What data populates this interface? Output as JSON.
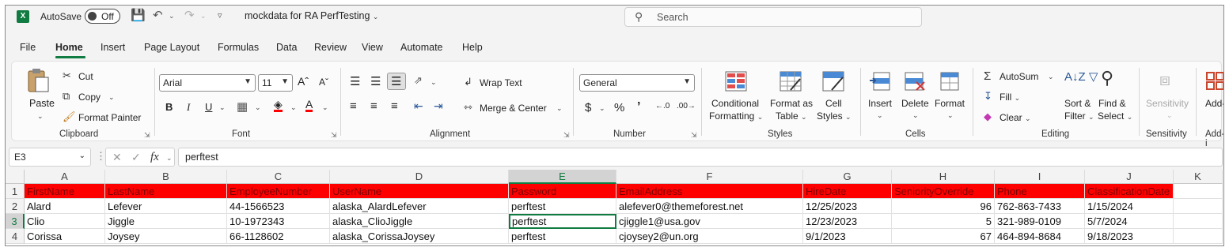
{
  "titlebar": {
    "app_logo": "X",
    "autosave_label": "AutoSave",
    "autosave_state": "Off",
    "document_title": "mockdata for RA PerfTesting",
    "search_placeholder": "Search"
  },
  "tabs": [
    "File",
    "Home",
    "Insert",
    "Page Layout",
    "Formulas",
    "Data",
    "Review",
    "View",
    "Automate",
    "Help"
  ],
  "active_tab": "Home",
  "ribbon": {
    "clipboard": {
      "paste": "Paste",
      "cut": "Cut",
      "copy": "Copy",
      "format_painter": "Format Painter",
      "label": "Clipboard"
    },
    "font": {
      "font_name": "Arial",
      "font_size": "11",
      "label": "Font"
    },
    "alignment": {
      "wrap_text": "Wrap Text",
      "merge_center": "Merge & Center",
      "label": "Alignment"
    },
    "number": {
      "format": "General",
      "label": "Number"
    },
    "styles": {
      "conditional_1": "Conditional",
      "conditional_2": "Formatting",
      "format_as_1": "Format as",
      "format_as_2": "Table",
      "cell_1": "Cell",
      "cell_2": "Styles",
      "label": "Styles"
    },
    "cells": {
      "insert": "Insert",
      "delete": "Delete",
      "format": "Format",
      "label": "Cells"
    },
    "editing": {
      "autosum": "AutoSum",
      "fill": "Fill",
      "clear": "Clear",
      "sort_1": "Sort &",
      "sort_2": "Filter",
      "find_1": "Find &",
      "find_2": "Select",
      "label": "Editing"
    },
    "sensitivity": {
      "button": "Sensitivity",
      "label": "Sensitivity"
    },
    "addins": {
      "button": "Add-i",
      "label": "Add-i"
    }
  },
  "formula_bar": {
    "name_box": "E3",
    "fx": "fx",
    "formula": "perftest"
  },
  "columns": [
    "A",
    "B",
    "C",
    "D",
    "E",
    "F",
    "G",
    "H",
    "I",
    "J",
    "K"
  ],
  "rows": [
    "1",
    "2",
    "3",
    "4"
  ],
  "header_row": [
    "FirstName",
    "LastName",
    "EmployeeNumber",
    "UserName",
    "Password",
    "EmailAddress",
    "HireDate",
    "SeniorityOverride",
    "Phone",
    "ClassificationDate"
  ],
  "data_rows": [
    [
      "Alard",
      "Lefever",
      "44-1566523",
      "alaska_AlardLefever",
      "perftest",
      "alefever0@themeforest.net",
      "12/25/2023",
      "96",
      "762-863-7433",
      "1/15/2024"
    ],
    [
      "Clio",
      "Jiggle",
      "10-1972343",
      "alaska_ClioJiggle",
      "perftest",
      "cjiggle1@usa.gov",
      "12/23/2023",
      "5",
      "321-989-0109",
      "5/7/2024"
    ],
    [
      "Corissa",
      "Joysey",
      "66-1128602",
      "alaska_CorissaJoysey",
      "perftest",
      "cjoysey2@un.org",
      "9/1/2023",
      "67",
      "464-894-8684",
      "9/18/2023"
    ]
  ],
  "selected_cell": "E3",
  "colors": {
    "accent": "#107c41",
    "header_fill": "#ff0000"
  }
}
